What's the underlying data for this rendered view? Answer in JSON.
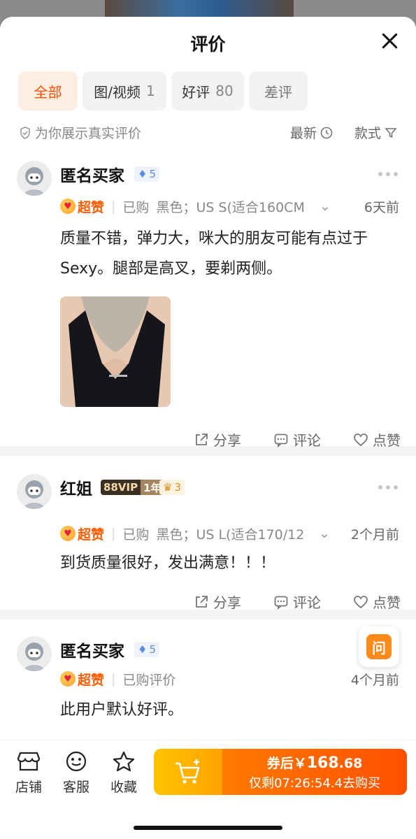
{
  "header": {
    "title": "评价"
  },
  "tabs": [
    {
      "label": "全部",
      "count": ""
    },
    {
      "label": "图/视频",
      "count": "1"
    },
    {
      "label": "好评",
      "count": "80"
    },
    {
      "label": "差评",
      "count": ""
    }
  ],
  "subbar": {
    "note": "为你展示真实评价",
    "sort": "最新",
    "filter": "款式"
  },
  "reviews": [
    {
      "user": "匿名买家",
      "level": "5",
      "badge": "超赞",
      "purchased": "已购",
      "spec": "黑色；US S(适合160CM",
      "time": "6天前",
      "content": "质量不错，弹力大，咪大的朋友可能有点过于Sexy。腿部是高叉，要剃两侧。",
      "share": "分享",
      "comment": "评论",
      "like": "点赞"
    },
    {
      "user": "红姐",
      "vip": "88VIP",
      "vip_years": "1年",
      "level": "3",
      "badge": "超赞",
      "purchased": "已购",
      "spec": "黑色；US L(适合170/12",
      "time": "2个月前",
      "content": "到货质量很好，发出满意！！！",
      "share": "分享",
      "comment": "评论",
      "like": "点赞"
    },
    {
      "user": "匿名买家",
      "level": "5",
      "badge": "超赞",
      "purchased": "已购评价",
      "time": "4个月前",
      "content": "此用户默认好评。"
    }
  ],
  "ask": {
    "label": "问"
  },
  "bottom": {
    "shop": "店铺",
    "service": "客服",
    "favorite": "收藏",
    "price_prefix": "券后￥",
    "price_int": "168",
    "price_dec": ".68",
    "countdown_prefix": "仅剩",
    "countdown": "07:26:54.4",
    "countdown_suffix": "去购买"
  },
  "colors": {
    "accent": "#ff5000",
    "brand_orange": "#ff7a00",
    "cart_yellow": "#ffb000"
  }
}
